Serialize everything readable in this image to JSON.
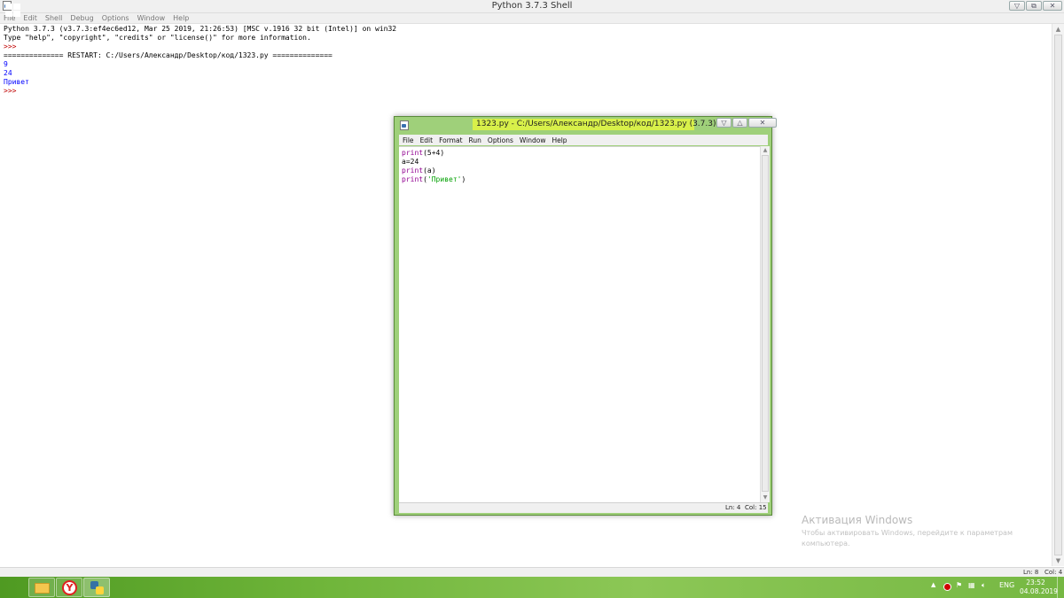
{
  "shell": {
    "title": "Python 3.7.3 Shell",
    "menu": [
      "File",
      "Edit",
      "Shell",
      "Debug",
      "Options",
      "Window",
      "Help"
    ],
    "lines": {
      "l1": "Python 3.7.3 (v3.7.3:ef4ec6ed12, Mar 25 2019, 21:26:53) [MSC v.1916 32 bit (Intel)] on win32",
      "l2": "Type \"help\", \"copyright\", \"credits\" or \"license()\" for more information.",
      "l3": ">>> ",
      "l4": "============== RESTART: C:/Users/Александр/Desktop/код/1323.py ==============",
      "l5": "9",
      "l6": "24",
      "l7": "Привет",
      "l8": ">>> "
    },
    "status": {
      "ln": "Ln: 8",
      "col": "Col: 4"
    }
  },
  "editor": {
    "title": "1323.py - C:/Users/Александр/Desktop/код/1323.py (3.7.3)",
    "menu": [
      "File",
      "Edit",
      "Format",
      "Run",
      "Options",
      "Window",
      "Help"
    ],
    "code": {
      "l1_fn": "print",
      "l1_rest": "(5+4)",
      "l2": "a=24",
      "l3_fn": "print",
      "l3_rest": "(a)",
      "l4_fn": "print",
      "l4_open": "(",
      "l4_str": "'Привет'",
      "l4_close": ")"
    },
    "status": {
      "ln": "Ln: 4",
      "col": "Col: 15"
    }
  },
  "watermark": {
    "title": "Активация Windows",
    "subtitle": "Чтобы активировать Windows, перейдите к параметрам компьютера."
  },
  "taskbar": {
    "language": "ENG",
    "time": "23:52",
    "date": "04.08.2019"
  },
  "colors": {
    "prompt": "#c00000",
    "output": "#0000ff",
    "keyword": "#900090",
    "string": "#00a000",
    "editor_frame": "#9fd07a",
    "taskbar": "#6fb53a"
  }
}
